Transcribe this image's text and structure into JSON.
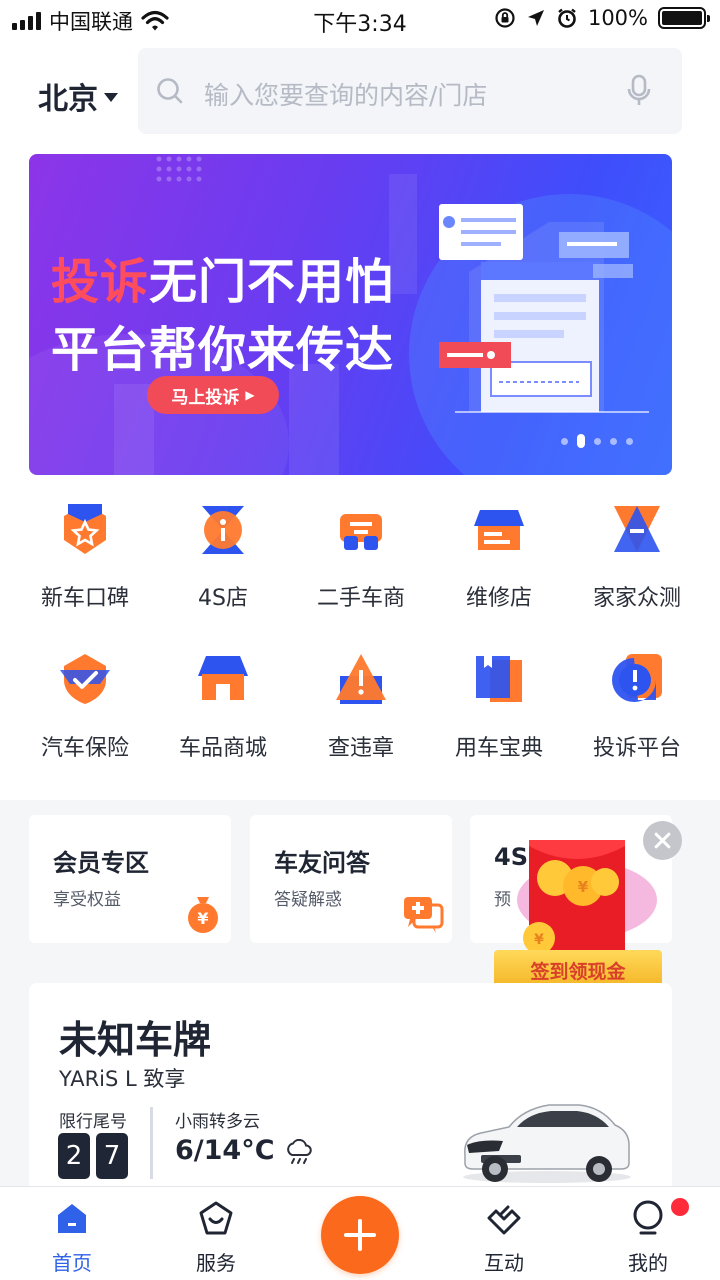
{
  "status_bar": {
    "carrier": "中国联通",
    "time": "下午3:34",
    "battery": "100%"
  },
  "header": {
    "city": "北京",
    "search_placeholder": "输入您要查询的内容/门店"
  },
  "banner": {
    "title_highlight": "投诉",
    "title_rest": "无门不用怕",
    "subtitle": "平台帮你来传达",
    "cta": "马上投诉",
    "slide_count": 5,
    "active_slide": 2
  },
  "grid": [
    {
      "label": "新车口碑",
      "icon": "medal-icon"
    },
    {
      "label": "4S店",
      "icon": "hourglass-store-icon"
    },
    {
      "label": "二手车商",
      "icon": "car-front-icon"
    },
    {
      "label": "维修店",
      "icon": "repair-shop-icon"
    },
    {
      "label": "家家众测",
      "icon": "test-icon"
    },
    {
      "label": "汽车保险",
      "icon": "shield-check-icon"
    },
    {
      "label": "车品商城",
      "icon": "store-icon"
    },
    {
      "label": "查违章",
      "icon": "warning-triangle-icon"
    },
    {
      "label": "用车宝典",
      "icon": "book-icon"
    },
    {
      "label": "投诉平台",
      "icon": "complaint-bubble-icon"
    }
  ],
  "promo_cards": [
    {
      "title": "会员专区",
      "subtitle": "享受权益"
    },
    {
      "title": "车友问答",
      "subtitle": "答疑解惑"
    },
    {
      "title": "4S",
      "subtitle": "预"
    }
  ],
  "red_packet": {
    "label": "签到领现金"
  },
  "car_card": {
    "plate": "未知车牌",
    "model": "YARiS L 致享",
    "restriction_label": "限行尾号",
    "restriction_digits": [
      "2",
      "7"
    ],
    "weather": "小雨转多云",
    "temperature": "6/14°C"
  },
  "tab_bar": [
    {
      "label": "首页",
      "active": true
    },
    {
      "label": "服务",
      "active": false
    },
    {
      "label": "互动",
      "active": false
    },
    {
      "label": "我的",
      "active": false
    }
  ],
  "colors": {
    "accent_blue": "#2f62e8",
    "accent_orange": "#fb6a1c",
    "banner_red": "#f14b57"
  }
}
